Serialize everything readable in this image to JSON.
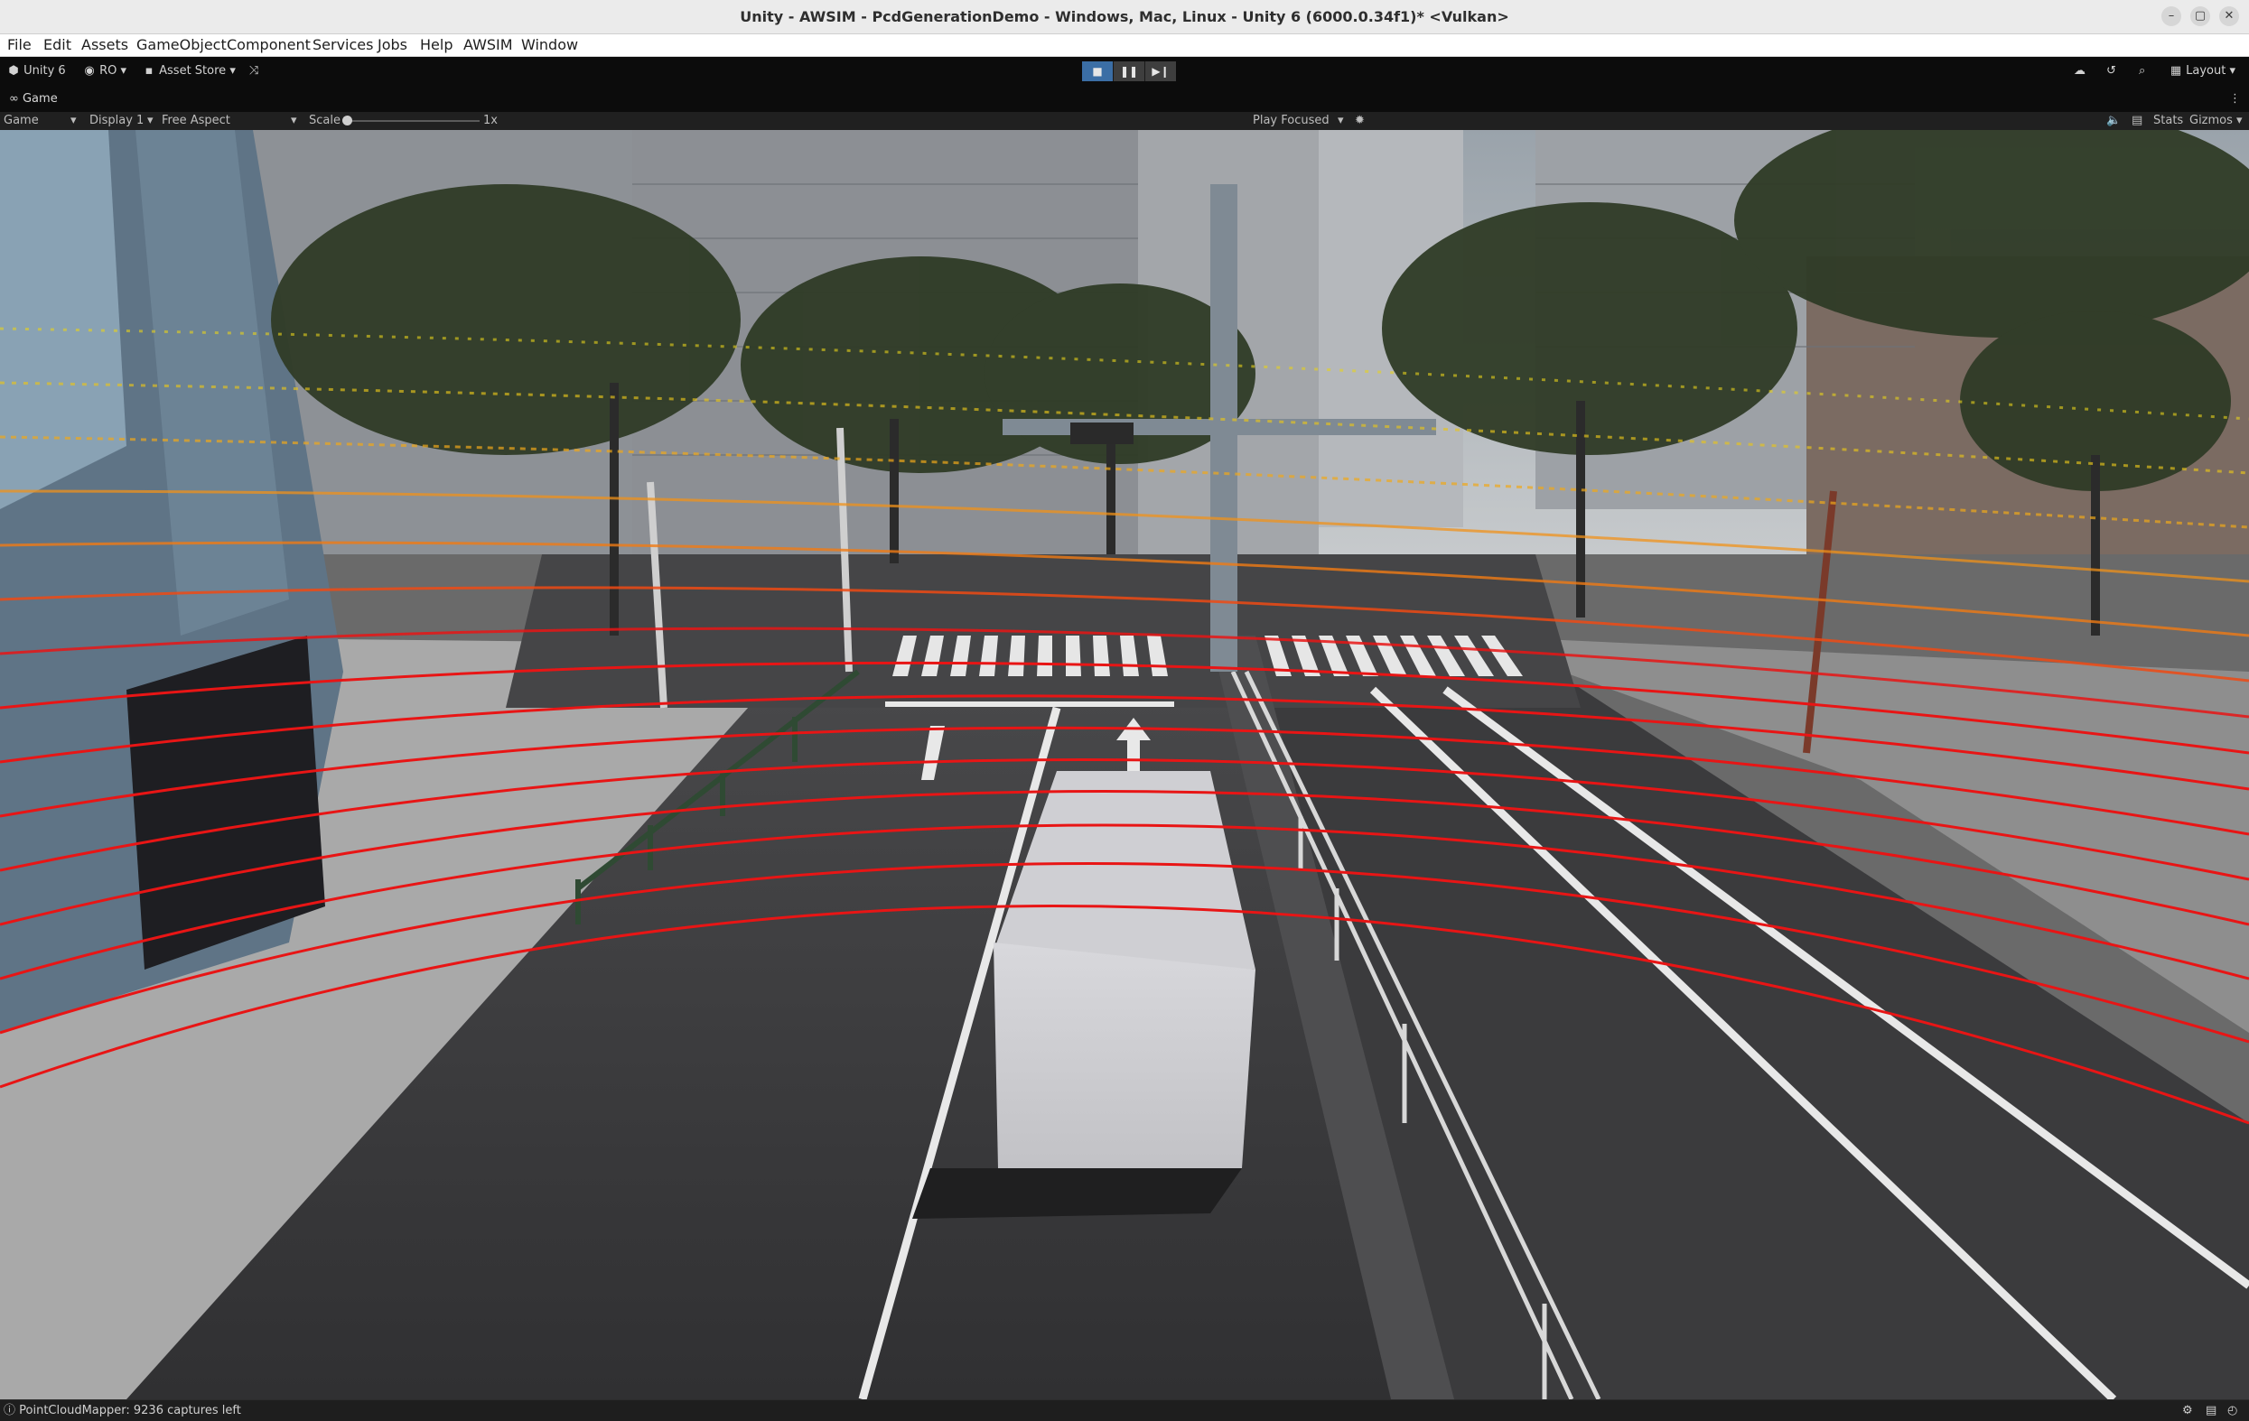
{
  "window": {
    "title": "Unity - AWSIM - PcdGenerationDemo - Windows, Mac, Linux - Unity 6 (6000.0.34f1)* <Vulkan>"
  },
  "menu": {
    "items": [
      "File",
      "Edit",
      "Assets",
      "GameObject",
      "Component",
      "Services",
      "Jobs",
      "Help",
      "AWSIM",
      "Window"
    ]
  },
  "toolbar": {
    "unity_label": "Unity 6",
    "account_label": "RO",
    "asset_store_label": "Asset Store",
    "layout_label": "Layout"
  },
  "tab": {
    "game_label": "Game"
  },
  "gamebar": {
    "view_select": "Game",
    "display_select": "Display 1",
    "aspect_select": "Free Aspect",
    "scale_label": "Scale",
    "scale_value": "1x",
    "play_mode_select": "Play Focused",
    "stats_label": "Stats",
    "gizmos_label": "Gizmos"
  },
  "status": {
    "message": "PointCloudMapper: 9236 captures left"
  },
  "colors": {
    "toolbar_bg": "#0c0c0c",
    "active_play": "#3b6ea5",
    "lidar_near": "#e81515",
    "lidar_mid": "#f07a14",
    "lidar_far": "#e8d21a"
  },
  "icons": [
    "unity-logo-icon",
    "account-icon",
    "asset-store-icon",
    "version-control-icon",
    "stop-icon",
    "pause-icon",
    "step-icon",
    "cloud-icon",
    "history-icon",
    "search-icon",
    "layout-icon",
    "more-icon",
    "game-icon",
    "mute-icon",
    "stats-icon",
    "gizmo-icon",
    "info-icon",
    "console-icon"
  ]
}
